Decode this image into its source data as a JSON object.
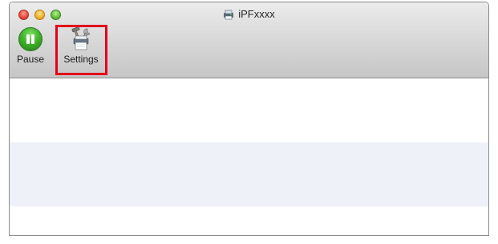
{
  "window": {
    "title": "iPFxxxx",
    "title_icon": "printer-folder-icon"
  },
  "traffic_lights": {
    "close": "#e84a3f",
    "minimize": "#f2b52c",
    "zoom": "#64c23a"
  },
  "toolbar": {
    "pause_label": "Pause",
    "pause_icon": "pause-circle-icon",
    "settings_label": "Settings",
    "settings_icon": "printer-tools-icon",
    "highlight_color": "#e3001b"
  },
  "content": {
    "row_colors": [
      "#ffffff",
      "#eef2f8"
    ]
  }
}
